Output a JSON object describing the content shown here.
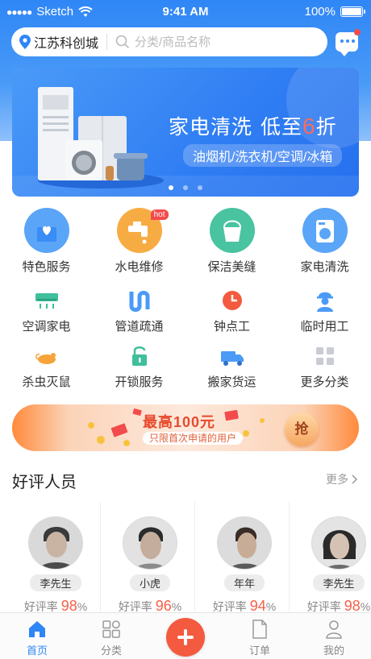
{
  "status_bar": {
    "carrier": "Sketch",
    "time": "9:41 AM",
    "battery": "100%"
  },
  "header": {
    "location": "江苏科创城",
    "search_placeholder": "分类/商品名称",
    "message_icon": "chat-bubble-icon"
  },
  "banner": {
    "title": "家电清洗",
    "subtitle_prefix": "低至",
    "discount_number": "6",
    "discount_suffix": "折",
    "tag": "油烟机/洗衣机/空调/冰箱",
    "page_count": 3,
    "active_page": 1
  },
  "categories": {
    "featured": [
      {
        "label": "特色服务",
        "icon": "heart-box-icon",
        "color": "#4b9bf6"
      },
      {
        "label": "水电维修",
        "icon": "faucet-icon",
        "color": "#f6a33a",
        "badge": "hot"
      },
      {
        "label": "保洁美缝",
        "icon": "bucket-icon",
        "color": "#3fbf9b"
      },
      {
        "label": "家电清洗",
        "icon": "washing-machine-icon",
        "color": "#4b9bf6"
      }
    ],
    "small": [
      {
        "label": "空调家电",
        "icon": "air-conditioner-icon"
      },
      {
        "label": "管道疏通",
        "icon": "pipe-icon"
      },
      {
        "label": "钟点工",
        "icon": "clock-icon"
      },
      {
        "label": "临时用工",
        "icon": "worker-icon"
      },
      {
        "label": "杀虫灭鼠",
        "icon": "mouse-icon"
      },
      {
        "label": "开锁服务",
        "icon": "lock-icon"
      },
      {
        "label": "搬家货运",
        "icon": "truck-icon"
      },
      {
        "label": "更多分类",
        "icon": "grid-icon"
      }
    ]
  },
  "promo": {
    "title": "最高100元",
    "subtitle": "只限首次申请的用户",
    "button": "抢"
  },
  "reviews": {
    "title": "好评人员",
    "more": "更多",
    "rate_label": "好评率",
    "people": [
      {
        "name": "李先生",
        "rate": "98",
        "unit": "%"
      },
      {
        "name": "小虎",
        "rate": "96",
        "unit": "%"
      },
      {
        "name": "年年",
        "rate": "94",
        "unit": "%"
      },
      {
        "name": "李先生",
        "rate": "98",
        "unit": "%"
      }
    ]
  },
  "tabbar": {
    "tabs": [
      {
        "label": "首页",
        "icon": "home-icon",
        "active": true
      },
      {
        "label": "分类",
        "icon": "category-grid-icon",
        "active": false
      },
      {
        "label": "",
        "icon": "plus-icon",
        "active": false
      },
      {
        "label": "订单",
        "icon": "order-doc-icon",
        "active": false
      },
      {
        "label": "我的",
        "icon": "user-icon",
        "active": false
      }
    ]
  },
  "colors": {
    "primary": "#2f86f6",
    "accent": "#f45a3f",
    "hot": "#f24b4b"
  }
}
